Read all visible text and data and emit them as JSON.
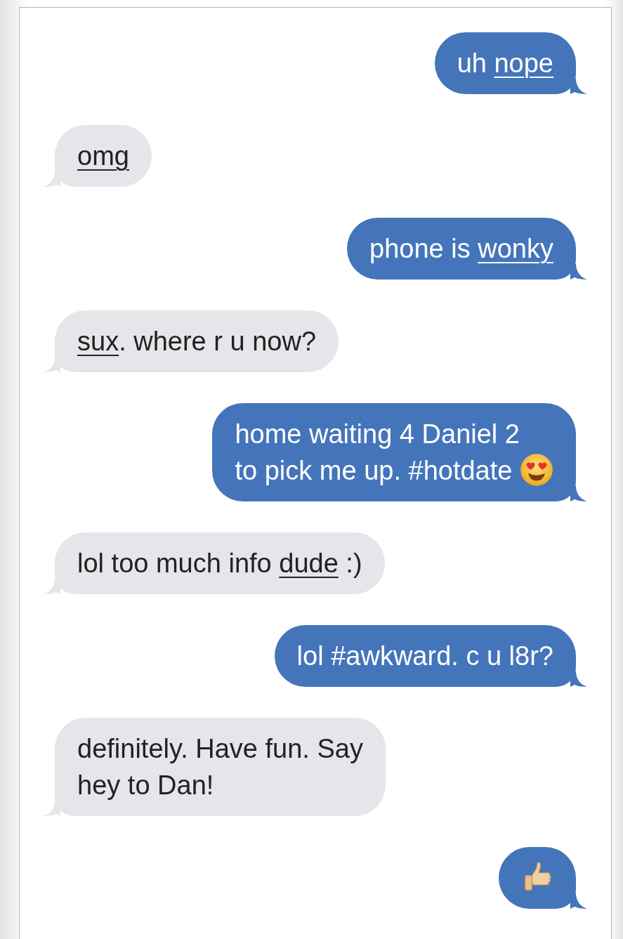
{
  "messages": [
    {
      "kind": "sent",
      "lines": [
        [
          {
            "kind": "text",
            "text": "uh "
          },
          {
            "kind": "link",
            "text": "nope"
          }
        ]
      ]
    },
    {
      "kind": "received",
      "lines": [
        [
          {
            "kind": "link",
            "text": "omg"
          }
        ]
      ]
    },
    {
      "kind": "sent",
      "lines": [
        [
          {
            "kind": "text",
            "text": "phone is "
          },
          {
            "kind": "link",
            "text": "wonky"
          }
        ]
      ]
    },
    {
      "kind": "received",
      "lines": [
        [
          {
            "kind": "link",
            "text": "sux"
          },
          {
            "kind": "text",
            "text": ". where r u now?"
          }
        ]
      ]
    },
    {
      "kind": "sent",
      "lines": [
        [
          {
            "kind": "text",
            "text": "home waiting 4 Daniel 2"
          }
        ],
        [
          {
            "kind": "text",
            "text": "to pick me up. #hotdate "
          },
          {
            "kind": "heart"
          }
        ]
      ]
    },
    {
      "kind": "received",
      "lines": [
        [
          {
            "kind": "text",
            "text": "lol too much info "
          },
          {
            "kind": "link",
            "text": "dude"
          },
          {
            "kind": "text",
            "text": " :)"
          }
        ]
      ]
    },
    {
      "kind": "sent",
      "lines": [
        [
          {
            "kind": "text",
            "text": "lol #awkward. c u l8r?"
          }
        ]
      ]
    },
    {
      "kind": "received",
      "lines": [
        [
          {
            "kind": "text",
            "text": "definitely. Have fun. Say"
          }
        ],
        [
          {
            "kind": "text",
            "text": "hey to Dan!"
          }
        ]
      ]
    },
    {
      "kind": "sent",
      "lines": [
        [
          {
            "kind": "thumb"
          }
        ]
      ]
    }
  ]
}
